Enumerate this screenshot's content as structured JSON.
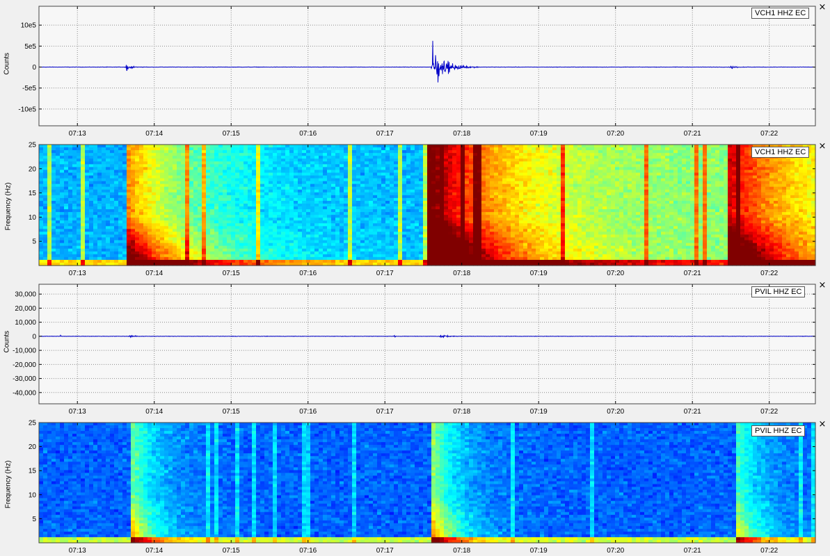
{
  "colors": {
    "waveform": "#0000c8",
    "plot_background": "#f7f7f7",
    "grid": "#8a8a8a",
    "window_background": "#f0f0f0"
  },
  "panels": [
    {
      "id": "p1",
      "kind": "waveform",
      "legend": "VCH1 HHZ EC",
      "ylabel": "Counts",
      "close_label": "×"
    },
    {
      "id": "p2",
      "kind": "spectrogram",
      "legend": "VCH1 HHZ EC",
      "ylabel": "Frequency (Hz)",
      "close_label": "×"
    },
    {
      "id": "p3",
      "kind": "waveform",
      "legend": "PVIL HHZ EC",
      "ylabel": "Counts",
      "close_label": "×"
    },
    {
      "id": "p4",
      "kind": "spectrogram",
      "legend": "PVIL HHZ EC",
      "ylabel": "Frequency (Hz)",
      "close_label": "×"
    }
  ],
  "chart_data": [
    {
      "type": "line",
      "title": "VCH1 HHZ EC",
      "ylabel": "Counts",
      "x_ticks": [
        "07:13",
        "07:14",
        "07:15",
        "07:16",
        "07:17",
        "07:18",
        "07:19",
        "07:20",
        "07:21",
        "07:22"
      ],
      "y_ticks": [
        "10e5",
        "5e5",
        "0",
        "-5e5",
        "-10e5"
      ],
      "y_tick_values": [
        1000000,
        500000,
        0,
        -500000,
        -1000000
      ],
      "ylim": [
        -1400000,
        1450000
      ],
      "xlim_minutes": [
        12.5,
        22.6
      ],
      "grid": true,
      "events": [
        {
          "time_min": 13.63,
          "amplitude": 80000,
          "duration_min": 0.25
        },
        {
          "time_min": 17.62,
          "amplitude": 580000,
          "duration_min": 0.5
        },
        {
          "time_min": 21.5,
          "amplitude": 60000,
          "duration_min": 0.2
        }
      ]
    },
    {
      "type": "heatmap",
      "title": "VCH1 HHZ EC",
      "ylabel": "Frequency (Hz)",
      "x_ticks": [
        "07:13",
        "07:14",
        "07:15",
        "07:16",
        "07:17",
        "07:18",
        "07:19",
        "07:20",
        "07:21",
        "07:22"
      ],
      "y_ticks": [
        "25",
        "20",
        "15",
        "10",
        "5"
      ],
      "y_tick_values": [
        25,
        20,
        15,
        10,
        5
      ],
      "ylim": [
        0,
        25
      ],
      "xlim_minutes": [
        12.5,
        22.6
      ],
      "onsets_min": [
        13.63,
        17.55,
        21.48
      ],
      "colormap": "jet"
    },
    {
      "type": "line",
      "title": "PVIL HHZ EC",
      "ylabel": "Counts",
      "x_ticks": [
        "07:13",
        "07:14",
        "07:15",
        "07:16",
        "07:17",
        "07:18",
        "07:19",
        "07:20",
        "07:21",
        "07:22"
      ],
      "y_ticks": [
        "30,000",
        "20,000",
        "10,000",
        "0",
        "-10,000",
        "-20,000",
        "-30,000",
        "-40,000"
      ],
      "y_tick_values": [
        30000,
        20000,
        10000,
        0,
        -10000,
        -20000,
        -30000,
        -40000
      ],
      "ylim": [
        -48000,
        37000
      ],
      "xlim_minutes": [
        12.5,
        22.6
      ],
      "grid": true,
      "events": [
        {
          "time_min": 12.78,
          "amplitude": 1800,
          "duration_min": 0.03
        },
        {
          "time_min": 13.68,
          "amplitude": 1500,
          "duration_min": 0.2
        },
        {
          "time_min": 17.12,
          "amplitude": 2000,
          "duration_min": 0.03
        },
        {
          "time_min": 17.72,
          "amplitude": 1600,
          "duration_min": 0.3
        }
      ]
    },
    {
      "type": "heatmap",
      "title": "PVIL HHZ EC",
      "ylabel": "Frequency (Hz)",
      "x_ticks": [
        "07:13",
        "07:14",
        "07:15",
        "07:16",
        "07:17",
        "07:18",
        "07:19",
        "07:20",
        "07:21",
        "07:22"
      ],
      "y_ticks": [
        "25",
        "20",
        "15",
        "10",
        "5"
      ],
      "y_tick_values": [
        25,
        20,
        15,
        10,
        5
      ],
      "ylim": [
        0,
        25
      ],
      "xlim_minutes": [
        12.5,
        22.6
      ],
      "onsets_min": [
        13.67,
        17.62,
        21.55
      ],
      "colormap": "jet"
    }
  ]
}
